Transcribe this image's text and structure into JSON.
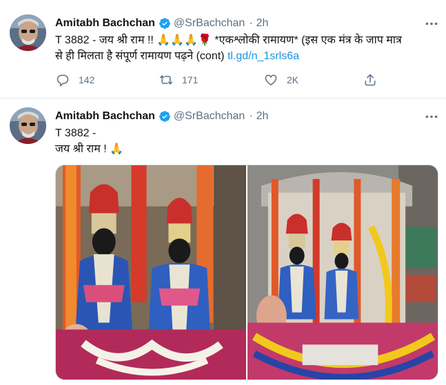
{
  "tweets": [
    {
      "author": {
        "name": "Amitabh Bachchan",
        "handle": "@SrBachchan"
      },
      "separator": "·",
      "time": "2h",
      "text_line1": "T 3882 - जय श्री राम !! 🙏🙏🙏🌹 *एकश्लोकी रामायण* (इस एक मंत्र के जाप मात्र",
      "text_line2": "से ही मिलता है संपूर्ण रामायण पढ़ने (cont)",
      "link": "tl.gd/n_1srls6a",
      "actions": {
        "replies": "142",
        "retweets": "171",
        "likes": "2K"
      }
    },
    {
      "author": {
        "name": "Amitabh Bachchan",
        "handle": "@SrBachchan"
      },
      "separator": "·",
      "time": "2h",
      "text_line1": "T 3882 -",
      "text_line2": "जय श्री राम  ! 🙏"
    }
  ],
  "icons": {
    "verified": "verified-badge-icon",
    "more": "more-options-icon",
    "reply": "reply-icon",
    "retweet": "retweet-icon",
    "like": "heart-icon",
    "share": "share-icon"
  },
  "colors": {
    "text": "#0f1419",
    "secondary": "#5b7083",
    "link": "#1b95e0",
    "verified": "#1da1f2",
    "divider": "#e6ecf0"
  }
}
